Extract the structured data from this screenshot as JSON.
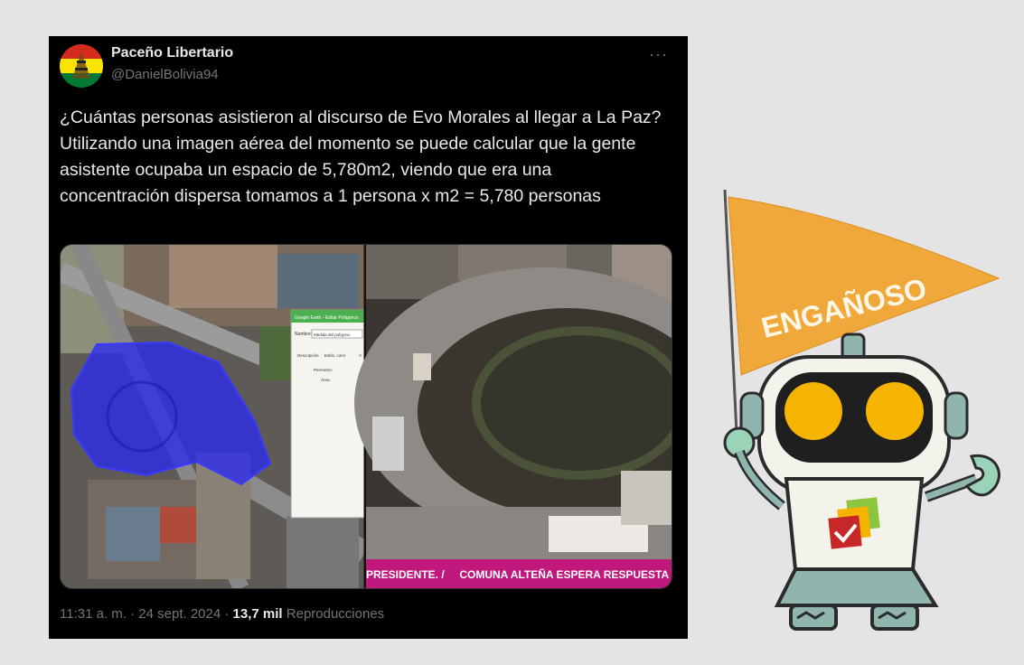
{
  "tweet": {
    "display_name": "Paceño Libertario",
    "handle": "@DanielBolivia94",
    "more_label": "···",
    "text_lines": [
      "¿Cuántas personas asistieron al discurso de Evo Morales al llegar a La Paz?",
      "Utilizando una imagen aérea del momento se puede calcular que la gente asistente ocupaba un espacio de 5,780m2, viendo que era una concentración dispersa tomamos a 1 persona x m2 = 5,780 personas"
    ],
    "time": "11:31 a. m.",
    "separator": "·",
    "date": "24 sept. 2024",
    "views_count": "13,7 mil",
    "views_label": "Reproducciones"
  },
  "media": {
    "tv_ticker": "PRESIDENTE. /     COMUNA ALTEÑA ESPERA RESPUESTA",
    "gearth_title": "Google Earth - Editar Polígonos",
    "gearth_name_label": "Nombre:",
    "gearth_name_value": "Medida del polígono",
    "gearth_col1": "Descripción",
    "gearth_col2": "Estilo, color",
    "gearth_col3": "V",
    "gearth_perimeter": "Perímetro:",
    "gearth_area": "Área:"
  },
  "label": {
    "verdict": "ENGAÑOSO"
  },
  "colors": {
    "tweet_bg": "#000000",
    "flag": "#f0a83a",
    "robot_body": "#8fb5ae",
    "robot_eye": "#f5b400",
    "polygon": "#2222ee"
  }
}
